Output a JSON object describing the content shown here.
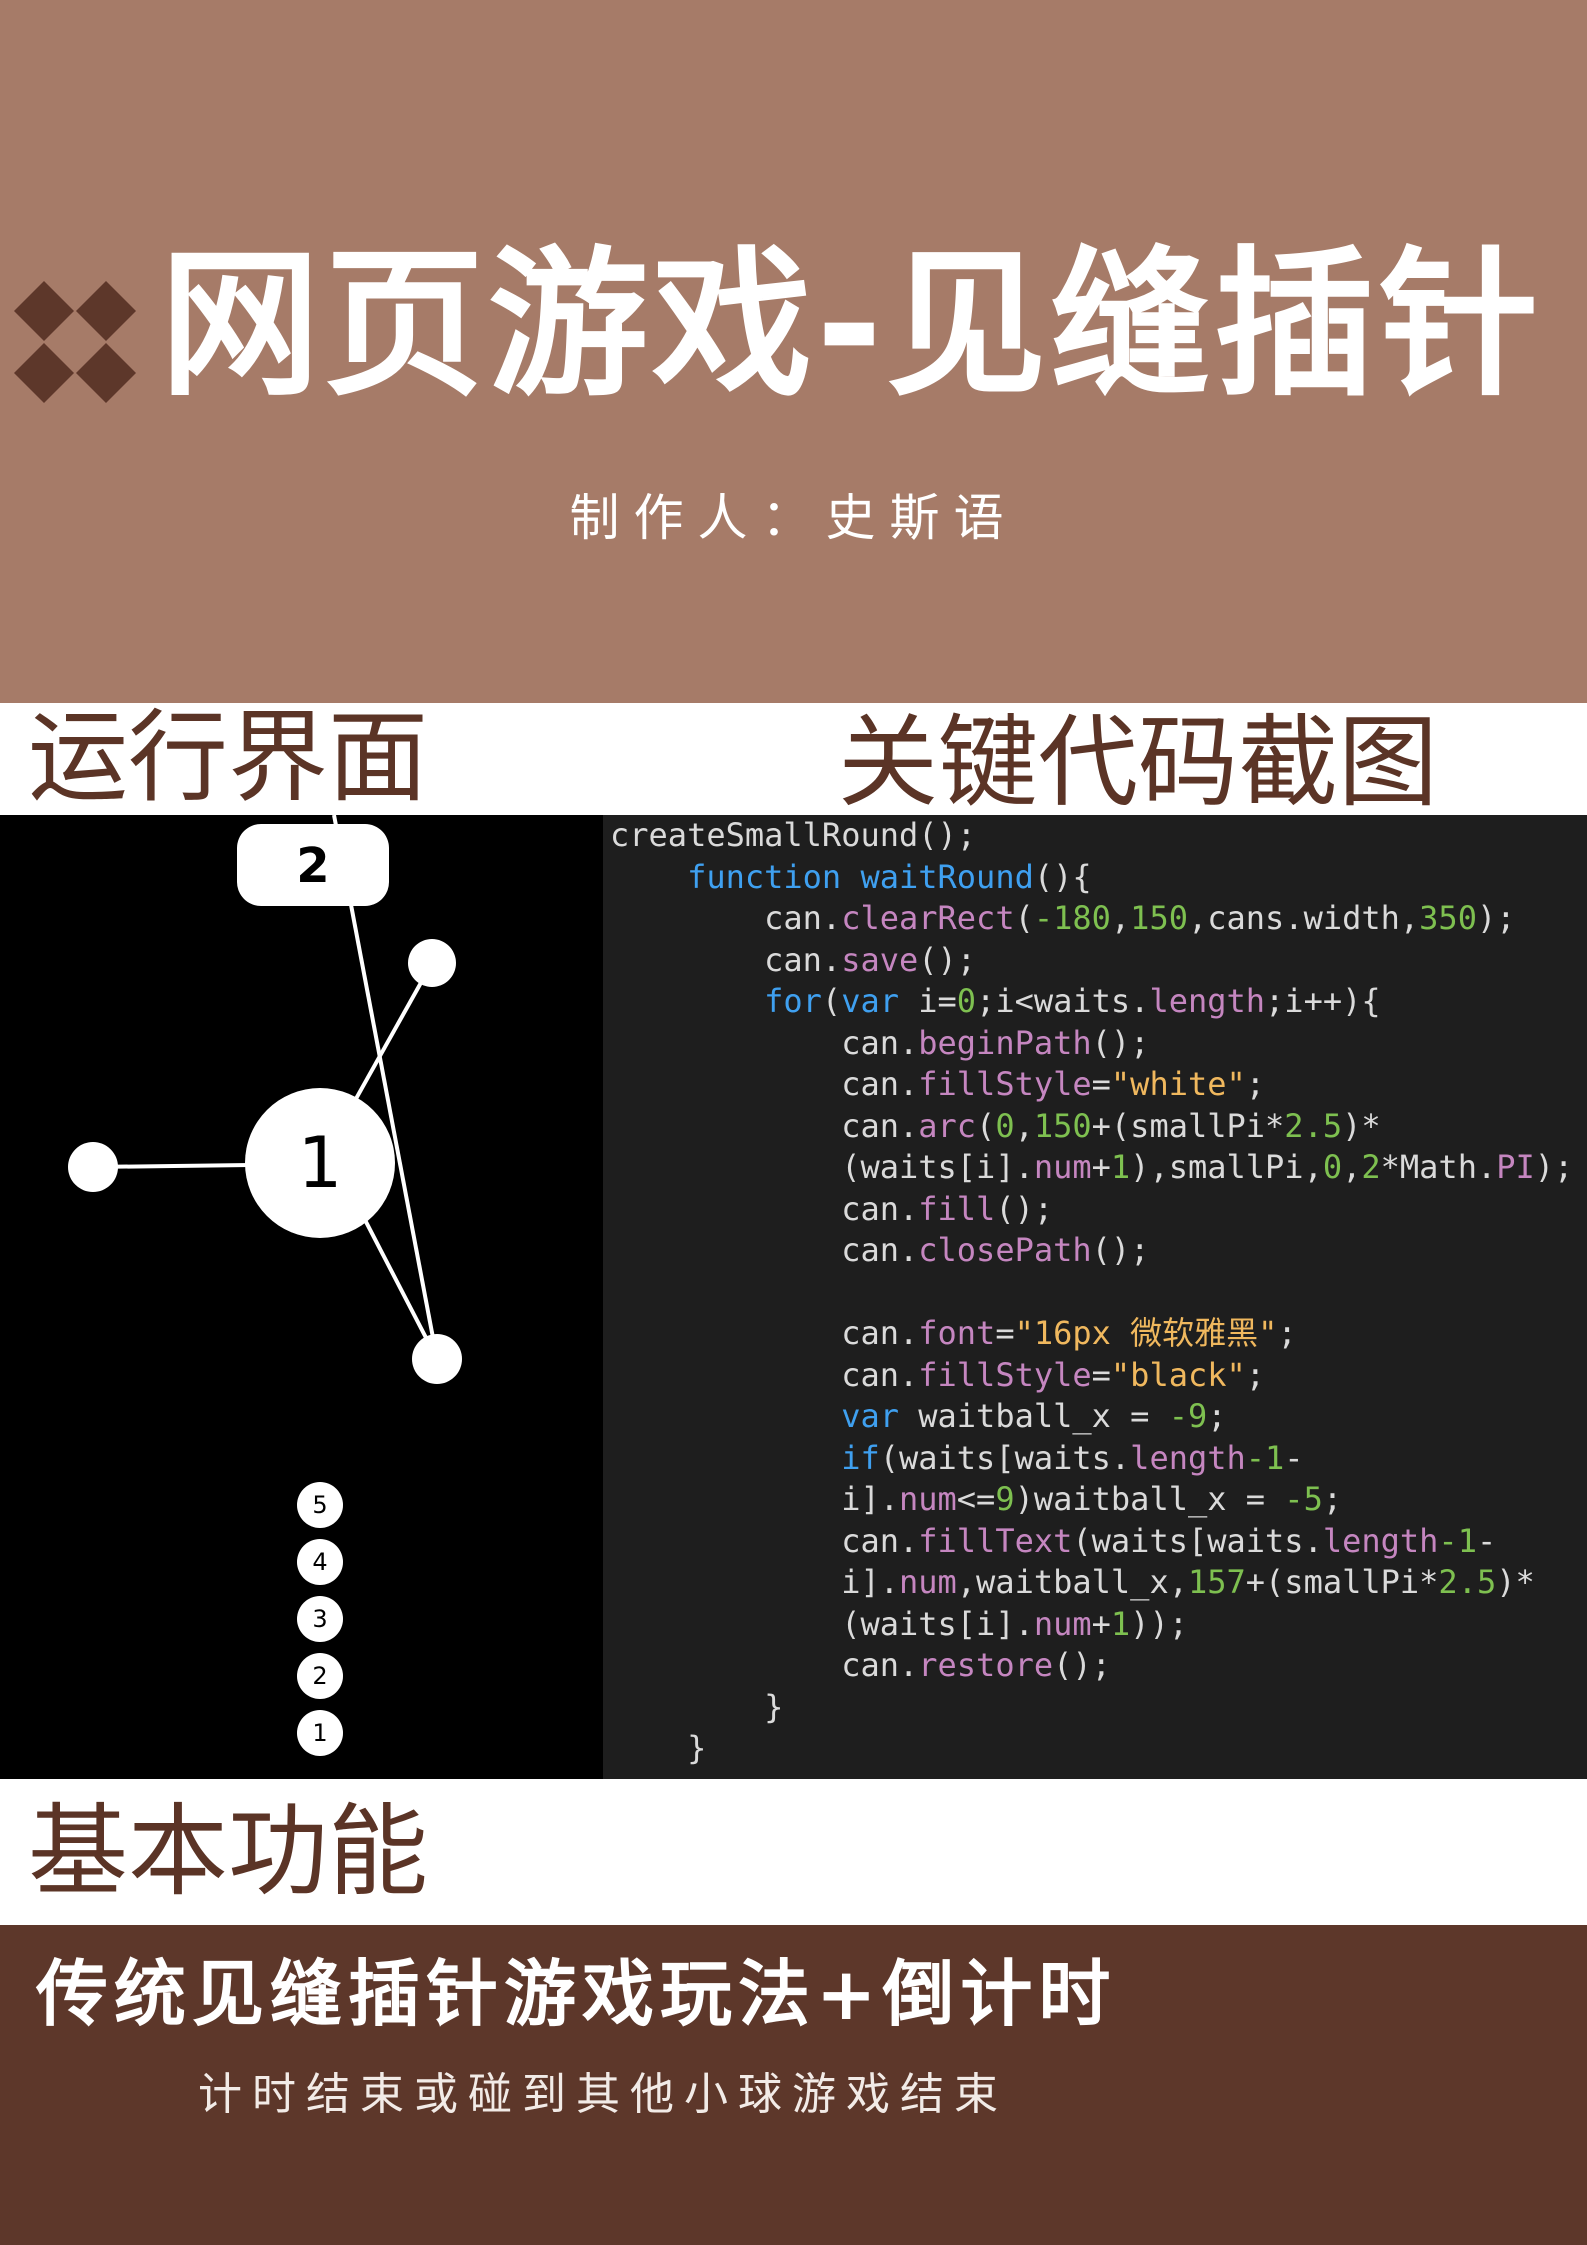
{
  "header": {
    "title": "网页游戏-见缝插针",
    "author": "制作人：史斯语"
  },
  "sections": {
    "runtime": "运行界面",
    "code": "关键代码截图",
    "basic": "基本功能"
  },
  "game": {
    "score": "2",
    "center_label": "1",
    "queue": [
      "5",
      "4",
      "3",
      "2",
      "1"
    ]
  },
  "code_lines": [
    "createSmallRound();",
    "    function waitRound(){",
    "        can.clearRect(-180,150,cans.width,350);",
    "        can.save();",
    "        for(var i=0;i<waits.length;i++){",
    "            can.beginPath();",
    "            can.fillStyle=\"white\";",
    "            can.arc(0,150+(smallPi*2.5)*",
    "            (waits[i].num+1),smallPi,0,2*Math.PI);",
    "            can.fill();",
    "            can.closePath();",
    "",
    "            can.font=\"16px 微软雅黑\";",
    "            can.fillStyle=\"black\";",
    "            var waitball_x = -9;",
    "            if(waits[waits.length-1-",
    "            i].num<=9)waitball_x = -5;",
    "            can.fillText(waits[waits.length-1-",
    "            i].num,waitball_x,157+(smallPi*2.5)*",
    "            (waits[i].num+1));",
    "            can.restore();",
    "        }",
    "    }"
  ],
  "features": {
    "title": "传统见缝插针游戏玩法+倒计时",
    "subtitle": "计时结束或碰到其他小球游戏结束"
  },
  "colors": {
    "header_bg": "#a67b68",
    "accent_dark": "#5d372a",
    "label_text": "#5b3426"
  }
}
